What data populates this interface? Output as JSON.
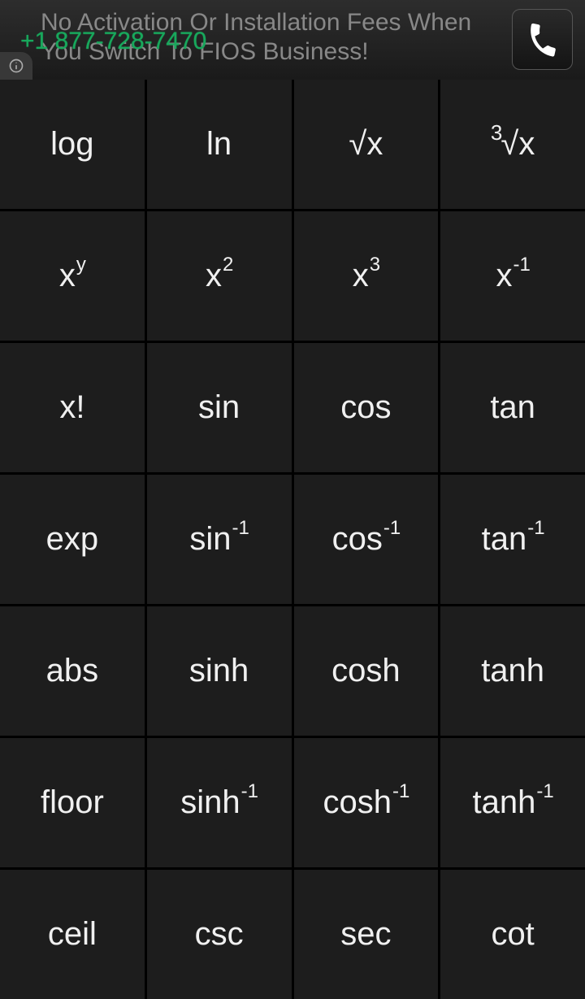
{
  "banner": {
    "ad_text": "No Activation Or Installation Fees When You Switch To FIOS Business!",
    "phone_number": "+1 877-728-7470"
  },
  "keys": {
    "log": {
      "base": "log"
    },
    "ln": {
      "base": "ln"
    },
    "sqrt": {
      "base": "√x"
    },
    "cbrt": {
      "pre": "3",
      "base": "√x"
    },
    "xy": {
      "base": "x",
      "sup": "y"
    },
    "x2": {
      "base": "x",
      "sup": "2"
    },
    "x3": {
      "base": "x",
      "sup": "3"
    },
    "xinv": {
      "base": "x",
      "sup": "-1"
    },
    "fact": {
      "base": "x!"
    },
    "sin": {
      "base": "sin"
    },
    "cos": {
      "base": "cos"
    },
    "tan": {
      "base": "tan"
    },
    "exp": {
      "base": "exp"
    },
    "asin": {
      "base": "sin",
      "sup": "-1"
    },
    "acos": {
      "base": "cos",
      "sup": "-1"
    },
    "atan": {
      "base": "tan",
      "sup": "-1"
    },
    "abs": {
      "base": "abs"
    },
    "sinh": {
      "base": "sinh"
    },
    "cosh": {
      "base": "cosh"
    },
    "tanh": {
      "base": "tanh"
    },
    "floor": {
      "base": "floor"
    },
    "asinh": {
      "base": "sinh",
      "sup": "-1"
    },
    "acosh": {
      "base": "cosh",
      "sup": "-1"
    },
    "atanh": {
      "base": "tanh",
      "sup": "-1"
    },
    "ceil": {
      "base": "ceil"
    },
    "csc": {
      "base": "csc"
    },
    "sec": {
      "base": "sec"
    },
    "cot": {
      "base": "cot"
    }
  }
}
